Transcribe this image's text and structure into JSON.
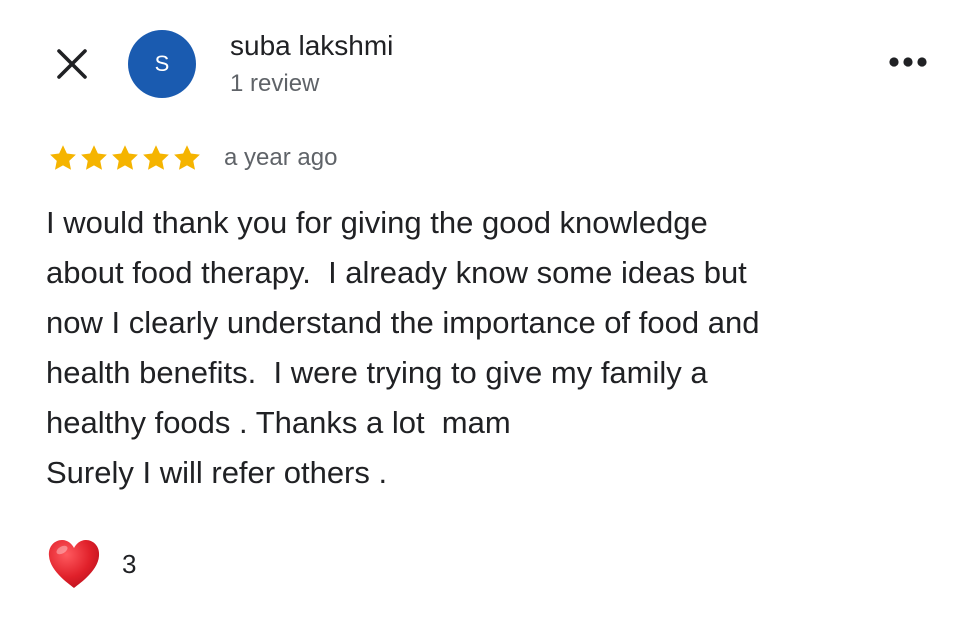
{
  "header": {
    "close_icon": "close-icon",
    "more_icon": "more-horizontal-icon"
  },
  "reviewer": {
    "avatar_initial": "S",
    "avatar_color": "#1a5bb0",
    "name": "suba lakshmi",
    "review_count": "1 review"
  },
  "review": {
    "rating": 5,
    "star_color": "#f5b400",
    "date": "a year ago",
    "text_lines": [
      "I would thank you for giving the good knowledge",
      "about food therapy.  I already know some ideas but",
      "now I clearly understand the importance of food and",
      "health benefits.  I were trying to give my family a",
      "healthy foods . Thanks a lot  mam",
      "Surely I will refer others ."
    ]
  },
  "reaction": {
    "icon": "heart-icon",
    "color": "#e0202a",
    "count": "3"
  }
}
